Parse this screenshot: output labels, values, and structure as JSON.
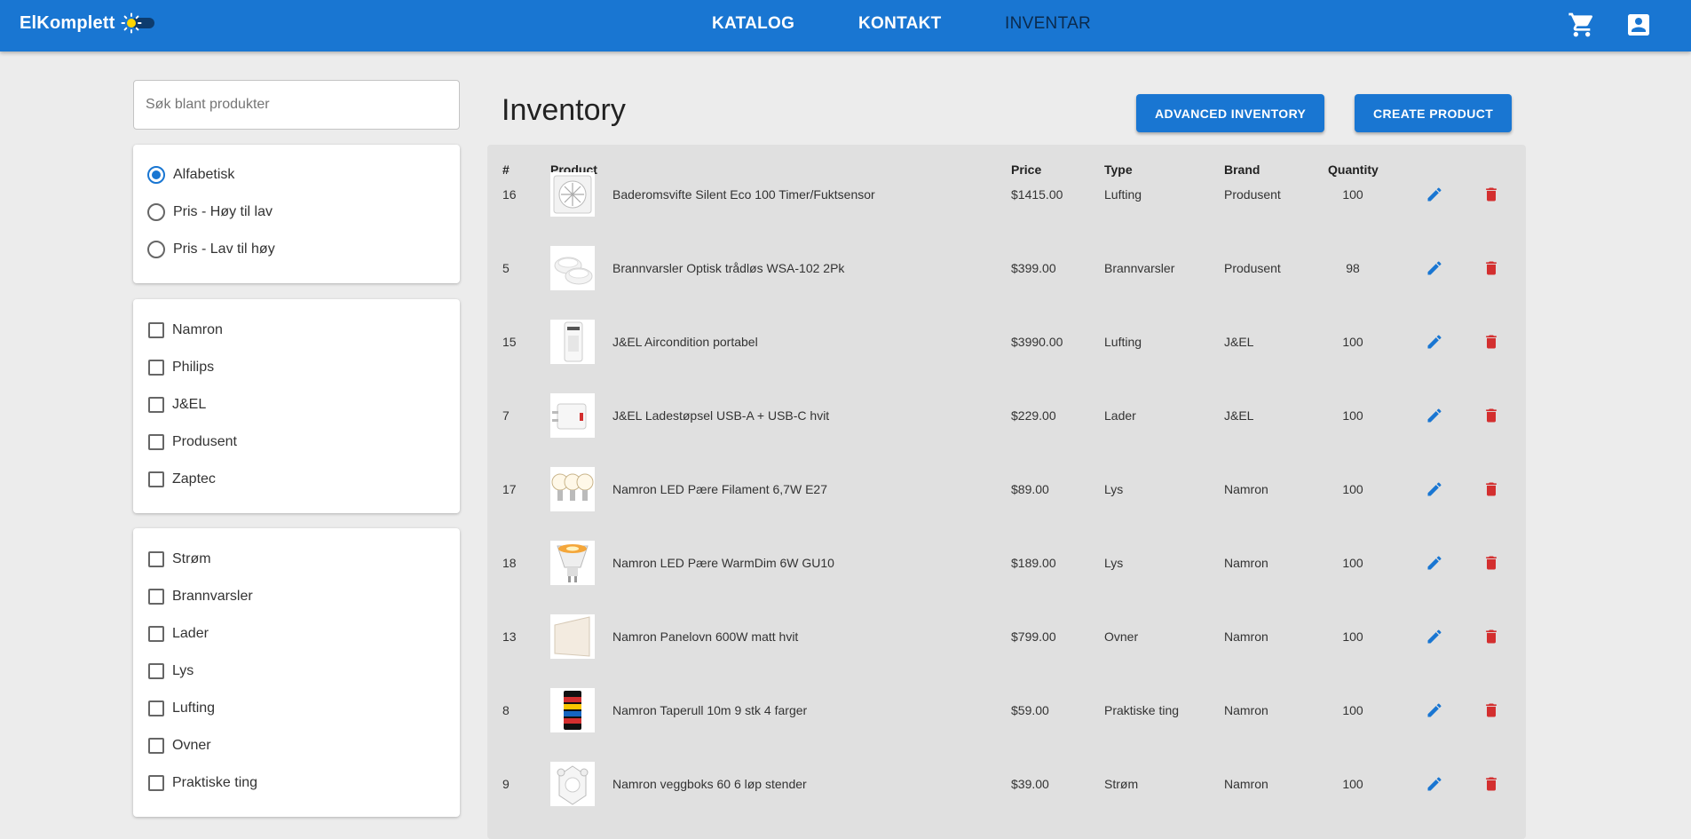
{
  "header": {
    "brand": "ElKomplett",
    "nav": [
      {
        "label": "KATALOG",
        "active": false
      },
      {
        "label": "KONTAKT",
        "active": false
      },
      {
        "label": "INVENTAR",
        "active": true
      }
    ],
    "icons": [
      "cart-icon",
      "account-icon",
      "sun-icon"
    ],
    "colors": {
      "primary": "#1976d2",
      "active_nav": "#0b2a4c"
    }
  },
  "sidebar": {
    "search_placeholder": "Søk blant produkter",
    "sort_options": [
      {
        "label": "Alfabetisk",
        "selected": true
      },
      {
        "label": "Pris - Høy til lav",
        "selected": false
      },
      {
        "label": "Pris - Lav til høy",
        "selected": false
      }
    ],
    "brands": [
      "Namron",
      "Philips",
      "J&EL",
      "Produsent",
      "Zaptec"
    ],
    "types": [
      "Strøm",
      "Brannvarsler",
      "Lader",
      "Lys",
      "Lufting",
      "Ovner",
      "Praktiske ting"
    ]
  },
  "main": {
    "title": "Inventory",
    "buttons": {
      "advanced": "ADVANCED INVENTORY",
      "create": "CREATE PRODUCT"
    },
    "columns": [
      "#",
      "Product",
      "Price",
      "Type",
      "Brand",
      "Quantity"
    ],
    "rows": [
      {
        "id": "16",
        "product": "Baderomsvifte Silent Eco 100 Timer/Fuktsensor",
        "price": "$1415.00",
        "type": "Lufting",
        "brand": "Produsent",
        "quantity": "100"
      },
      {
        "id": "5",
        "product": "Brannvarsler Optisk trådløs WSA-102 2Pk",
        "price": "$399.00",
        "type": "Brannvarsler",
        "brand": "Produsent",
        "quantity": "98"
      },
      {
        "id": "15",
        "product": "J&EL Aircondition portabel",
        "price": "$3990.00",
        "type": "Lufting",
        "brand": "J&EL",
        "quantity": "100"
      },
      {
        "id": "7",
        "product": "J&EL Ladestøpsel USB-A + USB-C hvit",
        "price": "$229.00",
        "type": "Lader",
        "brand": "J&EL",
        "quantity": "100"
      },
      {
        "id": "17",
        "product": "Namron LED Pære Filament 6,7W E27",
        "price": "$89.00",
        "type": "Lys",
        "brand": "Namron",
        "quantity": "100"
      },
      {
        "id": "18",
        "product": "Namron LED Pære WarmDim 6W GU10",
        "price": "$189.00",
        "type": "Lys",
        "brand": "Namron",
        "quantity": "100"
      },
      {
        "id": "13",
        "product": "Namron Panelovn 600W matt hvit",
        "price": "$799.00",
        "type": "Ovner",
        "brand": "Namron",
        "quantity": "100"
      },
      {
        "id": "8",
        "product": "Namron Taperull 10m 9 stk 4 farger",
        "price": "$59.00",
        "type": "Praktiske ting",
        "brand": "Namron",
        "quantity": "100"
      },
      {
        "id": "9",
        "product": "Namron veggboks 60 6 løp stender",
        "price": "$39.00",
        "type": "Strøm",
        "brand": "Namron",
        "quantity": "100"
      }
    ],
    "action_icons": [
      "edit-icon",
      "delete-icon"
    ],
    "action_colors": {
      "edit": "#1976d2",
      "delete": "#d32f2f"
    }
  }
}
